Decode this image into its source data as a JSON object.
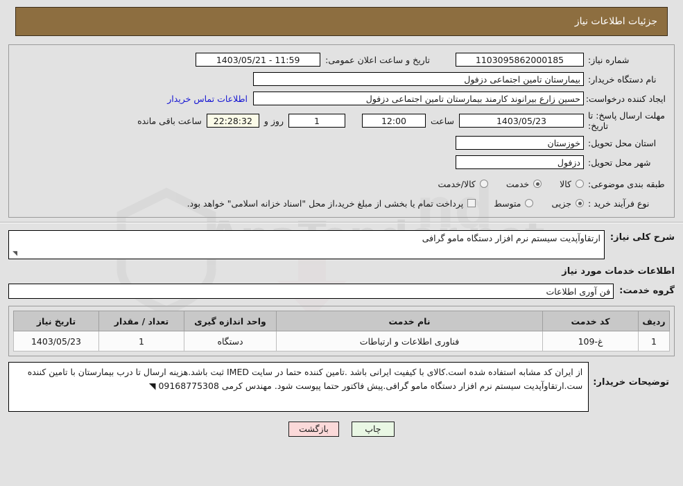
{
  "header": {
    "title": "جزئیات اطلاعات نیاز"
  },
  "form": {
    "need_number_label": "شماره نیاز:",
    "need_number_value": "1103095862000185",
    "announce_label": "تاریخ و ساعت اعلان عمومی:",
    "announce_value": "11:59 - 1403/05/21",
    "buyer_org_label": "نام دستگاه خریدار:",
    "buyer_org_value": "بیمارستان تامین اجتماعی دزفول",
    "creator_label": "ایجاد کننده درخواست:",
    "creator_value": "حسین زارع بیرانوند کارمند بیمارستان تامین اجتماعی دزفول",
    "contact_link": "اطلاعات تماس خریدار",
    "deadline_label": "مهلت ارسال پاسخ: تا تاریخ:",
    "deadline_date": "1403/05/23",
    "hour_label": "ساعت",
    "deadline_time": "12:00",
    "days_value": "1",
    "days_label": "روز و",
    "countdown_value": "22:28:32",
    "remaining_label": "ساعت باقی مانده",
    "province_label": "استان محل تحویل:",
    "province_value": "خوزستان",
    "city_label": "شهر محل تحویل:",
    "city_value": "دزفول",
    "category_label": "طبقه بندی موضوعی:",
    "category_options": [
      {
        "label": "کالا",
        "selected": false
      },
      {
        "label": "خدمت",
        "selected": true
      },
      {
        "label": "کالا/خدمت",
        "selected": false
      }
    ],
    "process_label": "نوع فرآیند خرید :",
    "process_options": [
      {
        "label": "جزیی",
        "selected": true
      },
      {
        "label": "متوسط",
        "selected": false
      }
    ],
    "treasury_checkbox_note": "پرداخت تمام یا بخشی از مبلغ خرید،از محل \"اسناد خزانه اسلامی\" خواهد بود."
  },
  "summary": {
    "label": "شرح کلی نیاز:",
    "value": "ارتقاوآپدیت سیستم نرم افزار دستگاه مامو گرافی"
  },
  "services_section": {
    "title": "اطلاعات خدمات مورد نیاز",
    "group_label": "گروه خدمت:",
    "group_value": "فن آوری اطلاعات"
  },
  "table": {
    "columns": [
      "ردیف",
      "کد خدمت",
      "نام خدمت",
      "واحد اندازه گیری",
      "تعداد / مقدار",
      "تاریخ نیاز"
    ],
    "rows": [
      {
        "row": "1",
        "code": "غ-109",
        "name": "فناوری اطلاعات و ارتباطات",
        "unit": "دستگاه",
        "quantity": "1",
        "date": "1403/05/23"
      }
    ]
  },
  "notes": {
    "label": "توضیحات خریدار:",
    "value": "از ایران کد مشابه استفاده شده است.کالای با کیفیت ایرانی باشد .تامین کننده حتما در سایت IMED ثبت باشد.هزینه ارسال تا درب بیمارستان با تامین کننده ست.ارتقاوآپدیت سیستم نرم افزار دستگاه مامو گرافی.پیش فاکتور حتما پیوست شود. مهندس کرمی 09168775308"
  },
  "buttons": {
    "print": "چاپ",
    "back": "بازگشت"
  },
  "colors": {
    "header_bar": "#8d6e40",
    "page_bg": "#e2e2e2",
    "link": "#1414d2",
    "print_btn": "#e9f7e4",
    "back_btn": "#fbd9d9",
    "countdown_bg": "#fbfbe8"
  },
  "watermark": {
    "text": "AnaTender.net"
  }
}
